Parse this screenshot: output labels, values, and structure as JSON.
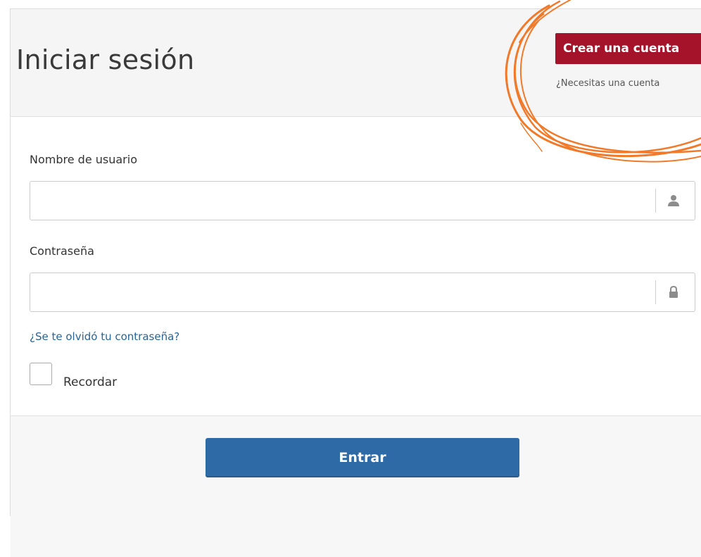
{
  "header": {
    "title": "Iniciar sesión",
    "create_account_label": "Crear una cuenta",
    "need_account_text": "¿Necesitas una cuenta"
  },
  "form": {
    "username": {
      "label": "Nombre de usuario",
      "value": "",
      "icon": "user-icon"
    },
    "password": {
      "label": "Contraseña",
      "value": "",
      "icon": "lock-icon"
    },
    "forgot_password_label": "¿Se te olvidó tu contraseña?",
    "remember_label": "Recordar",
    "remember_checked": false,
    "submit_label": "Entrar"
  },
  "colors": {
    "create_account_bg": "#a4132a",
    "submit_bg": "#2e6aa6",
    "link": "#2a6496",
    "annotation_circle": "#f07a2a"
  },
  "annotation": {
    "icon": "orange-circle-annotation"
  }
}
